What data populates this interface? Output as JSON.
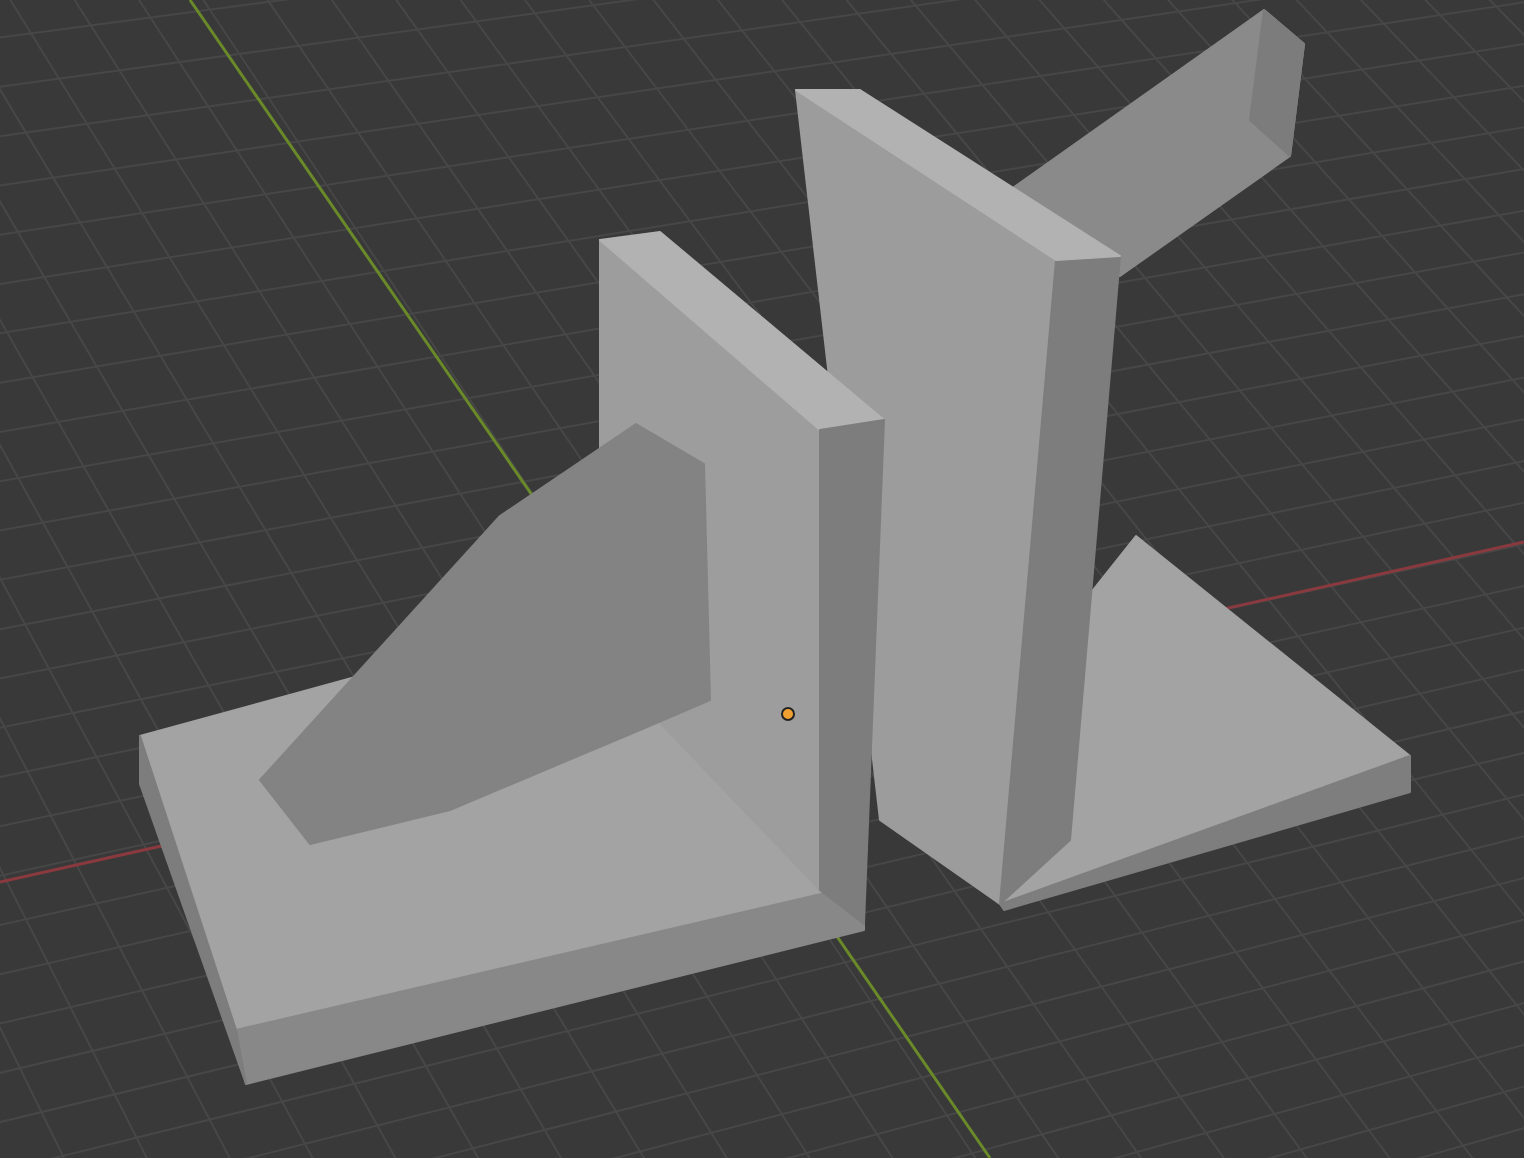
{
  "viewport": {
    "show_grid": true,
    "show_axes": true,
    "show_origin": true
  }
}
